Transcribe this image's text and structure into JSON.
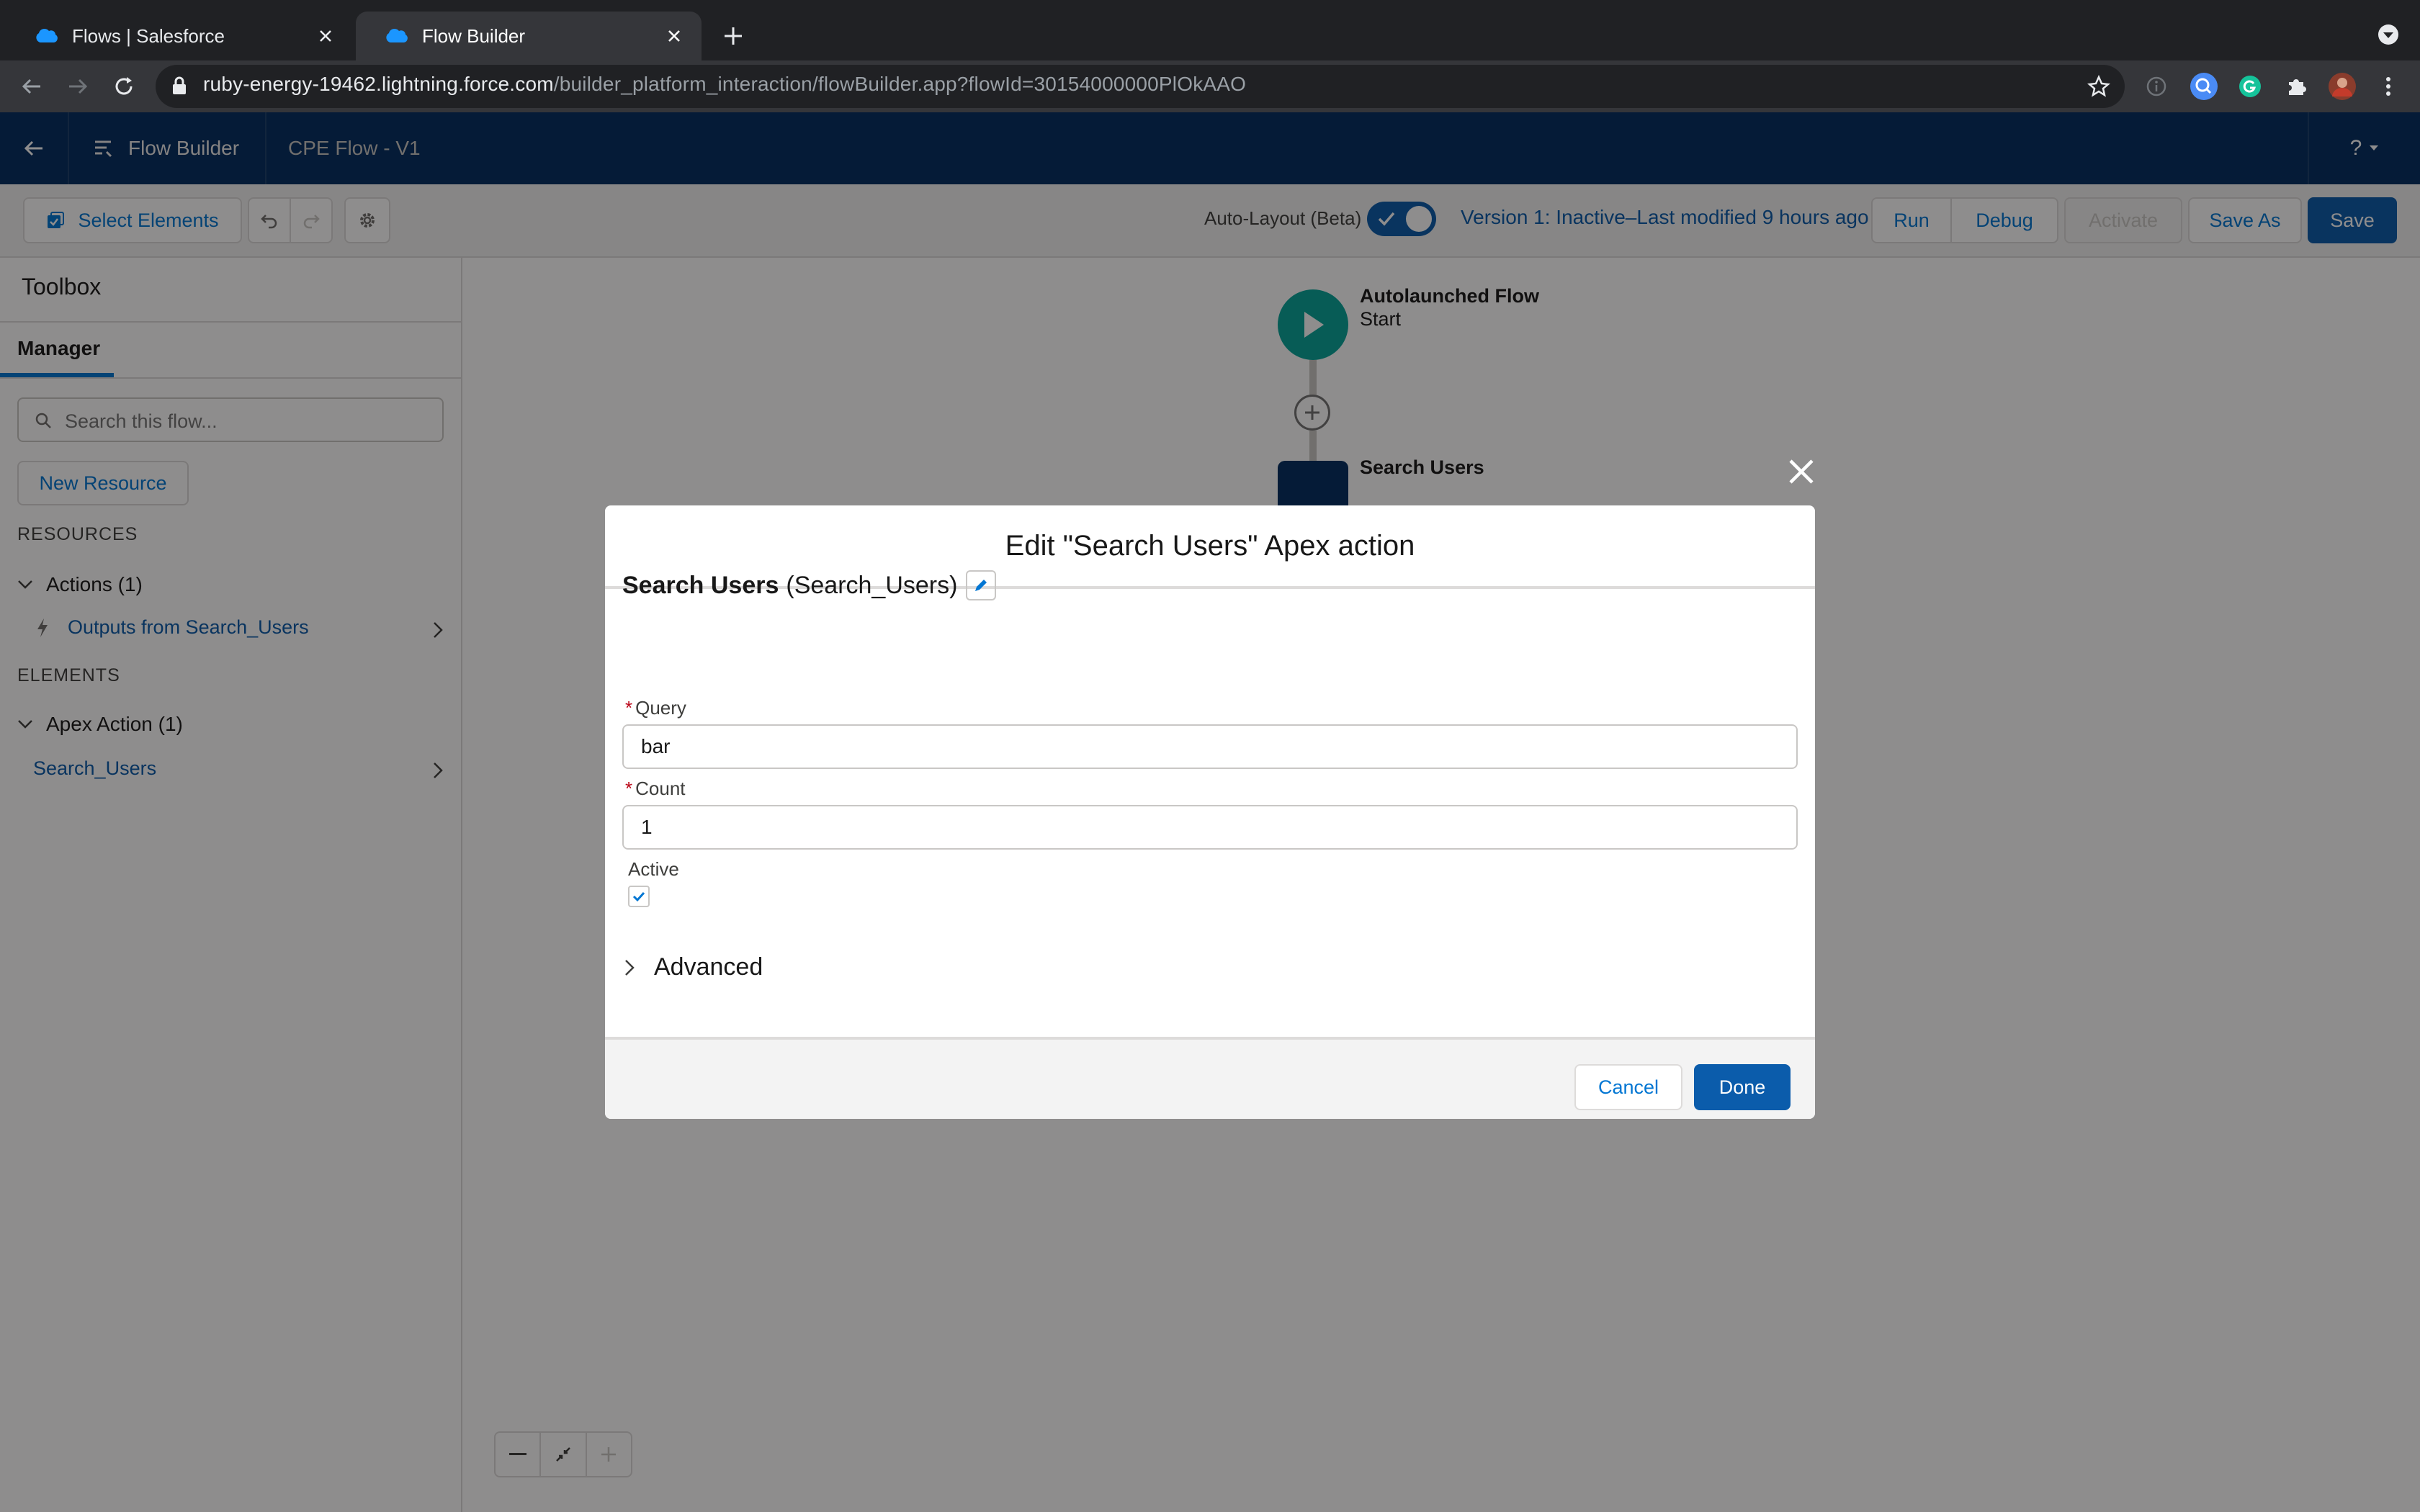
{
  "browser": {
    "tabs": [
      {
        "title": "Flows | Salesforce",
        "active": false
      },
      {
        "title": "Flow Builder",
        "active": true
      }
    ],
    "url_host": "ruby-energy-19462.lightning.force.com",
    "url_path": "/builder_platform_interaction/flowBuilder.app?flowId=30154000000PlOkAAO"
  },
  "header": {
    "app_name": "Flow Builder",
    "flow_name": "CPE Flow - V1",
    "help_label": "?"
  },
  "toolbar": {
    "select_elements_label": "Select Elements",
    "auto_layout_label": "Auto-Layout (Beta)",
    "auto_layout_on": true,
    "version_text": "Version 1: Inactive–Last modified 9 hours ago",
    "run_label": "Run",
    "debug_label": "Debug",
    "activate_label": "Activate",
    "save_as_label": "Save As",
    "save_label": "Save"
  },
  "sidebar": {
    "title": "Toolbox",
    "tab_label": "Manager",
    "search_placeholder": "Search this flow...",
    "new_resource_label": "New Resource",
    "resources_header": "RESOURCES",
    "actions_group": "Actions (1)",
    "actions_item": "Outputs from Search_Users",
    "elements_header": "ELEMENTS",
    "apex_group": "Apex Action (1)",
    "apex_item": "Search_Users"
  },
  "canvas": {
    "start_title": "Autolaunched Flow",
    "start_subtitle": "Start",
    "action_label": "Search Users"
  },
  "modal": {
    "title": "Edit \"Search Users\" Apex action",
    "element_label": "Search Users",
    "element_api_name": "(Search_Users)",
    "query_label": "Query",
    "query_value": "bar",
    "count_label": "Count",
    "count_value": "1",
    "active_label": "Active",
    "active_checked": true,
    "advanced_label": "Advanced",
    "cancel_label": "Cancel",
    "done_label": "Done"
  },
  "colors": {
    "header_bg": "#032d60",
    "brand_blue": "#0b5cab",
    "start_node": "#06a59a"
  }
}
